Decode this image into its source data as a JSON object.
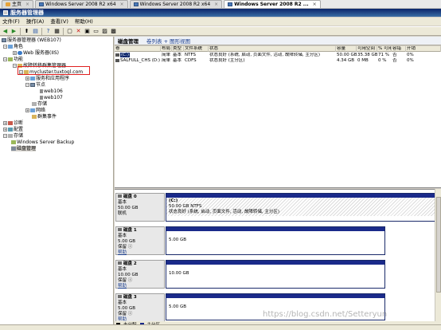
{
  "vm_tabs": [
    {
      "label": "主页",
      "active": false
    },
    {
      "label": "Windows Server 2008 R2 x64",
      "active": false
    },
    {
      "label": "Windows Server 2008 R2 x64",
      "active": false
    },
    {
      "label": "Windows Server 2008 R2 ...",
      "active": true
    }
  ],
  "window": {
    "title": "服务器管理器"
  },
  "menu": [
    "文件(F)",
    "操作(A)",
    "查看(V)",
    "帮助(H)"
  ],
  "toolbar_icons": [
    "back-icon",
    "forward-icon",
    "up-icon",
    "show-tree-icon",
    "help-icon",
    "properties-icon",
    "refresh-icon",
    "delete-icon",
    "new-icon",
    "open-icon",
    "save-icon",
    "settings-icon"
  ],
  "tree": {
    "root": "服务器管理器 (WEB107)",
    "roles": "角色",
    "web_server": "Web 服务器(IIS)",
    "features": "功能",
    "failover": "故障转移群集管理器",
    "cluster": "mycluster.tuxtogl.com",
    "services_apps": "服务和应用程序",
    "nodes": "节点",
    "node1": "web106",
    "node2": "web107",
    "storage": "存储",
    "networks": "网络",
    "cluster_events": "群集事件",
    "diagnostics": "诊断",
    "configuration": "配置",
    "storage2": "存储",
    "backup": "Windows Server Backup",
    "disk_mgmt": "磁盘管理"
  },
  "right_header": {
    "title": "磁盘管理",
    "links": "卷列表 + 图形视图"
  },
  "volume_table": {
    "columns": [
      "卷",
      "布局",
      "类型",
      "文件系统",
      "状态",
      "容量",
      "可用空间",
      "% 可用",
      "容错",
      "开销"
    ],
    "rows": [
      [
        "(C:)",
        "简单",
        "基本",
        "NTFS",
        "状态良好 (系统, 启动, 页面文件, 活动, 故障转储, 主分区)",
        "50.00 GB",
        "35.38 GB",
        "71 %",
        "否",
        "0%"
      ],
      [
        "SALFULL_CHS (D:)",
        "简单",
        "基本",
        "CDFS",
        "状态良好 (主分区)",
        "4.34 GB",
        "0 MB",
        "0 %",
        "否",
        "0%"
      ]
    ]
  },
  "disks": [
    {
      "name": "磁盘 0",
      "type": "基本",
      "size": "50.00 GB",
      "state": "联机",
      "part_name": "(C:)",
      "part_size": "50.00 GB NTFS",
      "part_status": "状态良好 (系统, 启动, 页面文件, 活动, 故障转储, 主分区)"
    },
    {
      "name": "磁盘 1",
      "type": "基本",
      "size": "5.00 GB",
      "state": "保留 ⓘ",
      "help": "帮助",
      "part_size": "5.00 GB"
    },
    {
      "name": "磁盘 2",
      "type": "基本",
      "size": "10.00 GB",
      "state": "保留 ⓘ",
      "help": "帮助",
      "part_size": "10.00 GB"
    },
    {
      "name": "磁盘 3",
      "type": "基本",
      "size": "5.00 GB",
      "state": "保留 ⓘ",
      "help": "帮助",
      "part_size": "5.00 GB"
    }
  ],
  "legend": [
    "未分配",
    "主分区"
  ],
  "watermark": "https://blog.csdn.net/Setteryun",
  "colors": {
    "primary_partition": "#1a2a8a",
    "highlight_box": "#e02020",
    "title_bar": "#0a246a"
  }
}
